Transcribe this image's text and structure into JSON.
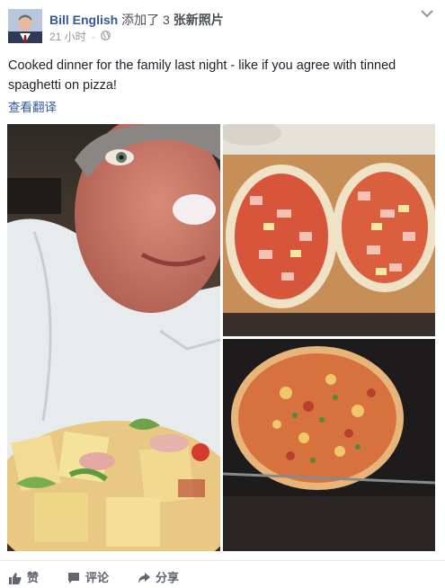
{
  "header": {
    "author": "Bill English",
    "action": "添加了",
    "count": "3",
    "photos_word": "张新照片",
    "time": "21 小时",
    "separator": "·",
    "avatar_icon": "profile-photo",
    "audience_icon": "globe-icon",
    "menu_icon": "chevron-down-icon"
  },
  "post": {
    "text": "Cooked dinner for the family last night - like if you agree with tinned spaghetti on pizza!",
    "translate": "查看翻译"
  },
  "photos": {
    "count": 3,
    "items": [
      {
        "name": "selfie-with-pizza"
      },
      {
        "name": "two-uncooked-pizzas"
      },
      {
        "name": "cooked-pizza-in-oven"
      }
    ]
  },
  "actions": {
    "like": "赞",
    "comment": "评论",
    "share": "分享"
  },
  "colors": {
    "link": "#365899",
    "meta": "#90949c",
    "action": "#606770"
  }
}
